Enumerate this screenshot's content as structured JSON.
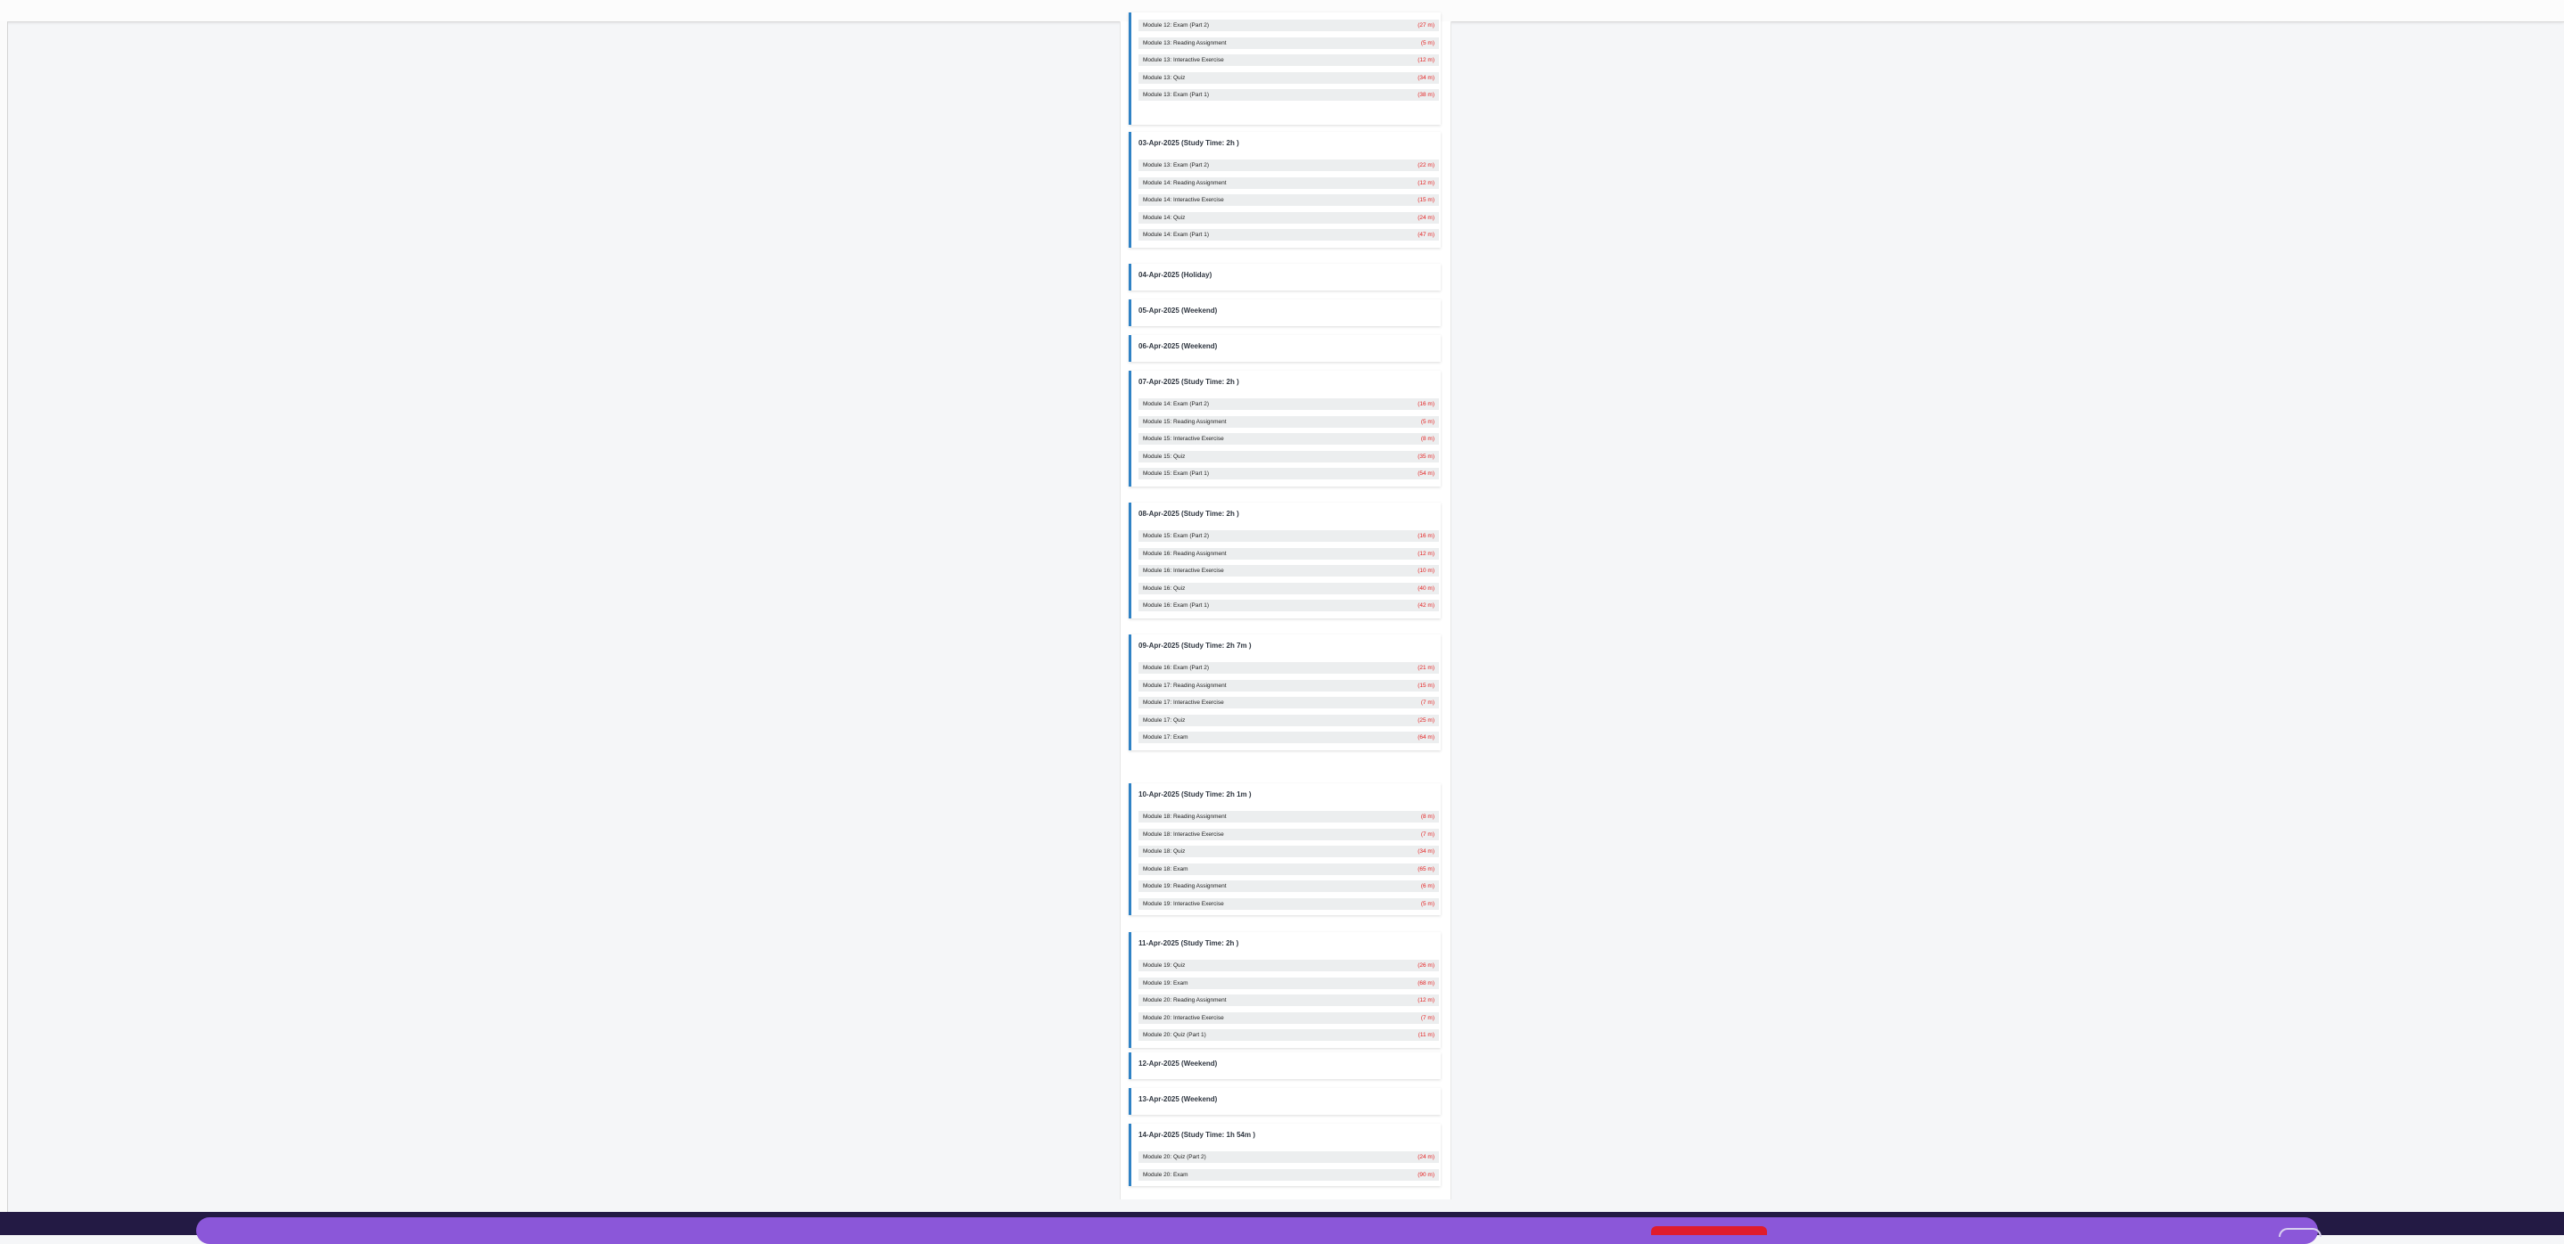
{
  "schedule": [
    {
      "header": "",
      "tasks": [
        {
          "name": "Module 12: Exam (Part 2)",
          "mins": "(27 m)"
        },
        {
          "name": "Module 13: Reading Assignment",
          "mins": "(5 m)"
        },
        {
          "name": "Module 13: Interactive Exercise",
          "mins": "(12 m)"
        },
        {
          "name": "Module 13: Quiz",
          "mins": "(34 m)"
        },
        {
          "name": "Module 13: Exam (Part 1)",
          "mins": "(38 m)"
        }
      ]
    },
    {
      "header": "03-Apr-2025 (Study Time: 2h )",
      "tasks": [
        {
          "name": "Module 13: Exam (Part 2)",
          "mins": "(22 m)"
        },
        {
          "name": "Module 14: Reading Assignment",
          "mins": "(12 m)"
        },
        {
          "name": "Module 14: Interactive Exercise",
          "mins": "(15 m)"
        },
        {
          "name": "Module 14: Quiz",
          "mins": "(24 m)"
        },
        {
          "name": "Module 14: Exam (Part 1)",
          "mins": "(47 m)"
        }
      ]
    },
    {
      "header": "04-Apr-2025 (Holiday)",
      "tasks": []
    },
    {
      "header": "05-Apr-2025 (Weekend)",
      "tasks": []
    },
    {
      "header": "06-Apr-2025 (Weekend)",
      "tasks": []
    },
    {
      "header": "07-Apr-2025 (Study Time: 2h )",
      "tasks": [
        {
          "name": "Module 14: Exam (Part 2)",
          "mins": "(16 m)"
        },
        {
          "name": "Module 15: Reading Assignment",
          "mins": "(5 m)"
        },
        {
          "name": "Module 15: Interactive Exercise",
          "mins": "(8 m)"
        },
        {
          "name": "Module 15: Quiz",
          "mins": "(35 m)"
        },
        {
          "name": "Module 15: Exam (Part 1)",
          "mins": "(54 m)"
        }
      ]
    },
    {
      "header": "08-Apr-2025 (Study Time: 2h )",
      "tasks": [
        {
          "name": "Module 15: Exam (Part 2)",
          "mins": "(16 m)"
        },
        {
          "name": "Module 16: Reading Assignment",
          "mins": "(12 m)"
        },
        {
          "name": "Module 16: Interactive Exercise",
          "mins": "(10 m)"
        },
        {
          "name": "Module 16: Quiz",
          "mins": "(40 m)"
        },
        {
          "name": "Module 16: Exam (Part 1)",
          "mins": "(42 m)"
        }
      ]
    },
    {
      "header": "09-Apr-2025 (Study Time: 2h 7m )",
      "tasks": [
        {
          "name": "Module 16: Exam (Part 2)",
          "mins": "(21 m)"
        },
        {
          "name": "Module 17: Reading Assignment",
          "mins": "(15 m)"
        },
        {
          "name": "Module 17: Interactive Exercise",
          "mins": "(7 m)"
        },
        {
          "name": "Module 17: Quiz",
          "mins": "(25 m)"
        },
        {
          "name": "Module 17: Exam",
          "mins": "(64 m)"
        }
      ]
    },
    {
      "header": "10-Apr-2025 (Study Time: 2h 1m )",
      "tasks": [
        {
          "name": "Module 18: Reading Assignment",
          "mins": "(8 m)"
        },
        {
          "name": "Module 18: Interactive Exercise",
          "mins": "(7 m)"
        },
        {
          "name": "Module 18: Quiz",
          "mins": "(34 m)"
        },
        {
          "name": "Module 18: Exam",
          "mins": "(65 m)"
        },
        {
          "name": "Module 19: Reading Assignment",
          "mins": "(6 m)"
        },
        {
          "name": "Module 19: Interactive Exercise",
          "mins": "(5 m)"
        }
      ]
    },
    {
      "header": "11-Apr-2025 (Study Time: 2h )",
      "tasks": [
        {
          "name": "Module 19: Quiz",
          "mins": "(26 m)"
        },
        {
          "name": "Module 19: Exam",
          "mins": "(68 m)"
        },
        {
          "name": "Module 20: Reading Assignment",
          "mins": "(12 m)"
        },
        {
          "name": "Module 20: Interactive Exercise",
          "mins": "(7 m)"
        },
        {
          "name": "Module 20: Quiz (Part 1)",
          "mins": "(11 m)"
        }
      ]
    },
    {
      "header": "12-Apr-2025 (Weekend)",
      "tasks": []
    },
    {
      "header": "13-Apr-2025 (Weekend)",
      "tasks": []
    },
    {
      "header": "14-Apr-2025 (Study Time: 1h 54m )",
      "tasks": [
        {
          "name": "Module 20: Quiz (Part 2)",
          "mins": "(24 m)"
        },
        {
          "name": "Module 20: Exam",
          "mins": "(90 m)"
        }
      ]
    }
  ]
}
